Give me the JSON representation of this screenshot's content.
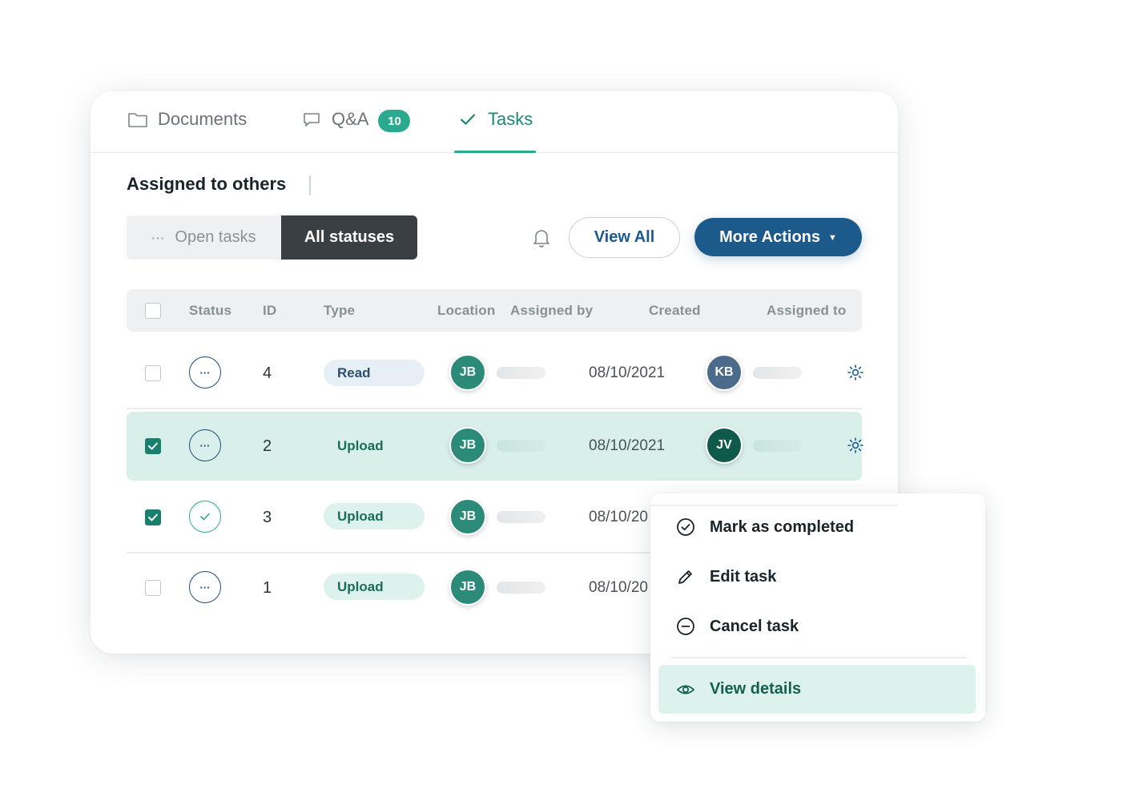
{
  "tabs": [
    {
      "label": "Documents",
      "icon": "folder-icon"
    },
    {
      "label": "Q&A",
      "icon": "comment-icon",
      "badge": "10"
    },
    {
      "label": "Tasks",
      "icon": "check-icon",
      "active": true
    }
  ],
  "section": {
    "title": "Assigned to others"
  },
  "filters": {
    "open_tasks": "Open tasks",
    "all_statuses": "All statuses",
    "selected": "All statuses"
  },
  "toolbar": {
    "view_all": "View All",
    "more_actions": "More Actions"
  },
  "table": {
    "columns": [
      "Status",
      "ID",
      "Type",
      "Location",
      "Assigned by",
      "Created",
      "Assigned to"
    ],
    "rows": [
      {
        "checked": false,
        "status": "pending",
        "id": "4",
        "type": "Read",
        "assigned_by": "JB",
        "created": "08/10/2021",
        "assigned_to": "KB"
      },
      {
        "checked": true,
        "status": "pending",
        "id": "2",
        "type": "Upload",
        "assigned_by": "JB",
        "created": "08/10/2021",
        "assigned_to": "JV"
      },
      {
        "checked": true,
        "status": "completed",
        "id": "3",
        "type": "Upload",
        "assigned_by": "JB",
        "created": "08/10/20"
      },
      {
        "checked": false,
        "status": "pending",
        "id": "1",
        "type": "Upload",
        "assigned_by": "JB",
        "created": "08/10/20"
      }
    ]
  },
  "context_menu": {
    "items": [
      {
        "label": "Mark as completed",
        "icon": "check-circle-icon"
      },
      {
        "label": "Edit task",
        "icon": "pencil-icon"
      },
      {
        "label": "Cancel task",
        "icon": "minus-circle-icon"
      },
      {
        "label": "View details",
        "icon": "eye-icon",
        "active": true
      }
    ]
  },
  "colors": {
    "accent_green": "#2aa98e",
    "primary_blue": "#1c5a8c",
    "selected_row": "#d9f0ea",
    "dark_segment": "#3a3f43"
  }
}
